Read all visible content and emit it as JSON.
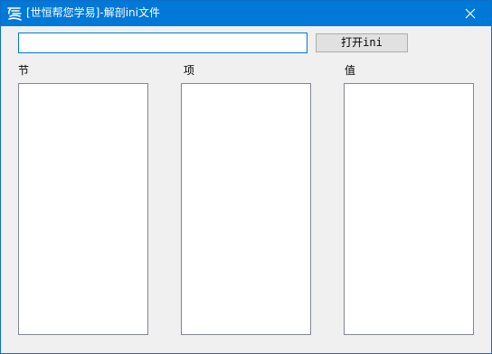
{
  "window": {
    "title": "[世恒帮您学易]-解剖ini文件",
    "accent_color": "#0078d7"
  },
  "icons": {
    "app": "app-logo-icon",
    "close": "close-icon"
  },
  "toolbar": {
    "path_value": "",
    "path_placeholder": "",
    "open_label": "打开ini"
  },
  "columns": [
    {
      "label": "节",
      "items": []
    },
    {
      "label": "项",
      "items": []
    },
    {
      "label": "值",
      "items": []
    }
  ]
}
